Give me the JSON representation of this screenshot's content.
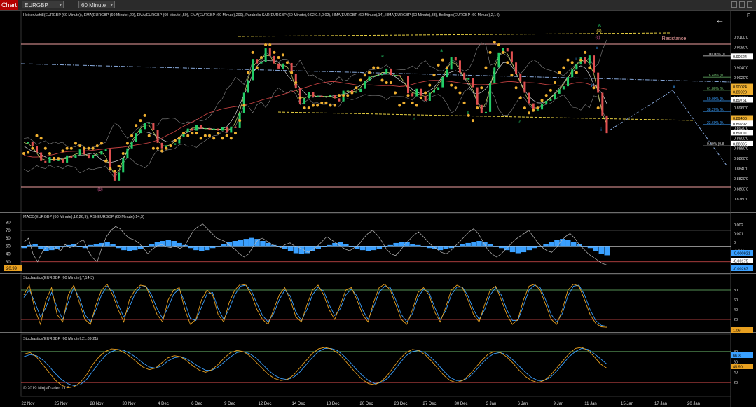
{
  "toolbar": {
    "chart_tab": "Chart",
    "instrument": "EURGBP",
    "timeframe": "60 Minute",
    "f_label": "F"
  },
  "colors": {
    "background": "#000000",
    "bullish": "#22cc66",
    "bearish": "#e05050",
    "psar": "#f0b030",
    "ema": "#c04040",
    "hma": "#d0d0d0",
    "macd_hist": "#3aa0ff",
    "stoch_k": "#e8a020",
    "stoch_d": "#3aa0ff",
    "resistance": "#f0a0a0",
    "channel": "#e8d040",
    "dashdot": "#88aadd"
  },
  "chart_data": [
    {
      "type": "line",
      "panel": "price",
      "title": "HeikenAshi8(EURGBP (60 Minute)), EMA(EURGBP (60 Minute),20), EMA(EURGBP (60 Minute),50), EMA(EURGBP (60 Minute),200), Parabolic SAR(EURGBP (60 Minute),0.02,0.2,0.02), HMA(EURGBP (60 Minute),14), HMA(EURGBP (60 Minute),33), Bollinger(EURGBP (60 Minute),2,14)",
      "x_labels": [
        "22 Nov",
        "25 Nov",
        "28 Nov",
        "30 Nov",
        "4 Dec",
        "6 Dec",
        "9 Dec",
        "12 Dec",
        "14 Dec",
        "18 Dec",
        "20 Dec",
        "23 Dec",
        "27 Dec",
        "30 Dec",
        "3 Jan",
        "6 Jan",
        "9 Jan",
        "11 Jan",
        "15 Jan",
        "17 Jan",
        "20 Jan"
      ],
      "y_ticks": [
        "0.9100'0",
        "0.9080'0",
        "0.9060'0",
        "0.9040'0",
        "0.9020'0",
        "0.9000'0",
        "0.8980'0",
        "0.8960'0",
        "0.8940'0",
        "0.8920'0",
        "0.8900'0",
        "0.8880'0",
        "0.8860'0",
        "0.8840'0",
        "0.8820'0",
        "0.8800'0",
        "0.8780'0"
      ],
      "ylim": [
        0.877,
        0.911
      ],
      "price_series": [
        0.889,
        0.8893,
        0.8884,
        0.8872,
        0.8855,
        0.8852,
        0.8863,
        0.8855,
        0.8859,
        0.8852,
        0.8866,
        0.8861,
        0.8867,
        0.8878,
        0.8868,
        0.886,
        0.8867,
        0.8868,
        0.8875,
        0.8878,
        0.8836,
        0.8816,
        0.8832,
        0.886,
        0.888,
        0.8893,
        0.891,
        0.8918,
        0.893,
        0.893,
        0.8917,
        0.8891,
        0.888,
        0.8886,
        0.8887,
        0.889,
        0.8903,
        0.8912,
        0.8919,
        0.8915,
        0.8926,
        0.8919,
        0.892,
        0.8917,
        0.8919,
        0.8915,
        0.8922,
        0.8911,
        0.8923,
        0.892,
        0.895,
        0.899,
        0.9015,
        0.9057,
        0.9048,
        0.9051,
        0.9078,
        0.9063,
        0.9048,
        0.9038,
        0.9048,
        0.9049,
        0.9028,
        0.8999,
        0.8967,
        0.8979,
        0.8992,
        0.8981,
        0.8984,
        0.8981,
        0.8983,
        0.8986,
        0.8979,
        0.8973,
        0.8994,
        0.8996,
        0.899,
        0.8992,
        0.8998,
        0.9013,
        0.9022,
        0.9023,
        0.9025,
        0.9028,
        0.9038,
        0.9025,
        0.9025,
        0.9024,
        0.9023,
        0.8989,
        0.8983,
        0.8998,
        0.8984,
        0.8974,
        0.899,
        0.8996,
        0.9001,
        0.9021,
        0.9036,
        0.906,
        0.9054,
        0.903,
        0.9016,
        0.9019,
        0.9001,
        0.8966,
        0.8949,
        0.8952,
        0.9009,
        0.904,
        0.907,
        0.9079,
        0.9072,
        0.905,
        0.9028,
        0.9012,
        0.899,
        0.8969,
        0.8955,
        0.8957,
        0.8968,
        0.8974,
        0.8977,
        0.8988,
        0.8997,
        0.9003,
        0.9021,
        0.9036,
        0.9046,
        0.906,
        0.9048,
        0.9064,
        0.903,
        0.899,
        0.8945,
        0.891
      ],
      "psar_series": [
        0.887,
        0.8872,
        0.888,
        0.8905,
        0.89,
        0.888,
        0.887,
        0.886,
        0.886,
        0.8875,
        0.888,
        0.888,
        0.889,
        0.8885,
        0.888,
        0.888,
        0.888,
        0.8885,
        0.889,
        0.8855,
        0.884,
        0.8835,
        0.8845,
        0.887,
        0.889,
        0.8905,
        0.8925,
        0.8935,
        0.8945,
        0.8905,
        0.888,
        0.888,
        0.8875,
        0.888,
        0.8885,
        0.8895,
        0.89,
        0.891,
        0.8905,
        0.891,
        0.891,
        0.89,
        0.8905,
        0.8905,
        0.89,
        0.891,
        0.89,
        0.8905,
        0.89,
        0.891,
        0.8935,
        0.8965,
        0.903,
        0.907,
        0.904,
        0.906,
        0.9085,
        0.9085,
        0.907,
        0.906,
        0.9065,
        0.905,
        0.903,
        0.901,
        0.898,
        0.896,
        0.896,
        0.8965,
        0.8965,
        0.897,
        0.897,
        0.8965,
        0.8965,
        0.8985,
        0.8985,
        0.8985,
        0.899,
        0.9,
        0.9015,
        0.9025,
        0.903,
        0.904,
        0.904,
        0.9015,
        0.901,
        0.901,
        0.899,
        0.8965,
        0.897,
        0.8985,
        0.897,
        0.8965,
        0.898,
        0.899,
        0.9005,
        0.9025,
        0.9045,
        0.9055,
        0.904,
        0.9005,
        0.9,
        0.899,
        0.897,
        0.8945,
        0.8935,
        0.896,
        0.9,
        0.904,
        0.907,
        0.909,
        0.9085,
        0.907,
        0.905,
        0.9025,
        0.9,
        0.898,
        0.896,
        0.895,
        0.8955,
        0.896,
        0.8975,
        0.8985,
        0.8995,
        0.901,
        0.903,
        0.904,
        0.9055,
        0.905,
        0.903,
        0.9055,
        0.907,
        0.904,
        0.9,
        0.896
      ],
      "right_axis_labels": [
        {
          "text": "0.90624",
          "value": 0.90624,
          "bg": "#ffffff",
          "fg": "#000000"
        },
        {
          "text": "0.90024",
          "value": 0.90024,
          "bg": "#f0b030",
          "fg": "#000000"
        },
        {
          "text": "0.89920",
          "value": 0.8992,
          "bg": "#f0b030",
          "fg": "#000000"
        },
        {
          "text": "0.89761",
          "value": 0.89761,
          "bg": "#ffffff",
          "fg": "#000000"
        },
        {
          "text": "0.89400",
          "value": 0.894,
          "bg": "#f0b030",
          "fg": "#000000"
        },
        {
          "text": "0.89292",
          "value": 0.89292,
          "bg": "#ffffff",
          "fg": "#000000"
        },
        {
          "text": "0.89110",
          "value": 0.8911,
          "bg": "#ffffff",
          "fg": "#000000"
        },
        {
          "text": "0.88895",
          "value": 0.88895,
          "bg": "#ffffff",
          "fg": "#000000"
        }
      ],
      "fib_levels": [
        {
          "label": "100.00% (0.",
          "value": 0.9063,
          "color": "#dddddd"
        },
        {
          "label": "76.40% (0.",
          "value": 0.9021,
          "color": "#6fbf6f"
        },
        {
          "label": "61.80% (0.",
          "value": 0.8995,
          "color": "#6fbf6f"
        },
        {
          "label": "50.00% (0.",
          "value": 0.8974,
          "color": "#3aa0ff"
        },
        {
          "label": "38.20% (0.",
          "value": 0.8953,
          "color": "#3aa0ff"
        },
        {
          "label": "23.60% (0.",
          "value": 0.8927,
          "color": "#3aa0ff"
        },
        {
          "label": "0.00% (0.8",
          "value": 0.8885,
          "color": "#dddddd"
        }
      ],
      "annotations": [
        {
          "text": "(b)",
          "color": "#e060a0"
        },
        {
          "text": "Resistance",
          "color": "#f0a0a0"
        },
        {
          "text": "(c)",
          "color": "#e060a0"
        },
        {
          "text": "B",
          "color": "#22cc66"
        },
        {
          "text": "(a)",
          "color": "#e8d040"
        },
        {
          "text": "v",
          "color": "#3aa0ff"
        },
        {
          "text": "iii",
          "color": "#3aa0ff"
        },
        {
          "text": "iv",
          "color": "#3aa0ff"
        },
        {
          "text": "i",
          "color": "#3aa0ff"
        },
        {
          "text": "ii",
          "color": "#3aa0ff"
        },
        {
          "text": "a",
          "color": "#22cc66"
        },
        {
          "text": "b",
          "color": "#22cc66"
        },
        {
          "text": "c",
          "color": "#22cc66"
        },
        {
          "text": "d",
          "color": "#22cc66"
        },
        {
          "text": "e",
          "color": "#22cc66"
        }
      ]
    },
    {
      "type": "line",
      "panel": "macd_rsi",
      "title": "MACD(EURGBP (60 Minute),12,26,9), RSI(EURGBP (60 Minute),14,3)",
      "left_ticks": [
        "80",
        "70",
        "60",
        "50",
        "40",
        "30"
      ],
      "right_ticks": [
        "0.002",
        "0.001",
        "0",
        "-0.001",
        "-0.002"
      ],
      "rsi_ylim": [
        20,
        85
      ],
      "rsi_series": [
        55,
        60,
        40,
        30,
        42,
        50,
        46,
        48,
        44,
        52,
        48,
        50,
        55,
        58,
        44,
        35,
        30,
        48,
        62,
        70,
        75,
        72,
        65,
        60,
        58,
        54,
        48,
        40,
        46,
        50,
        52,
        49,
        48,
        50,
        47,
        50,
        60,
        70,
        75,
        78,
        72,
        66,
        60,
        58,
        55,
        50,
        46,
        40,
        36,
        40,
        50,
        58,
        60,
        56,
        52,
        50,
        48,
        52,
        54,
        50,
        48,
        45,
        42,
        46,
        50,
        56,
        62,
        58,
        54,
        50,
        46,
        44,
        48,
        52,
        60,
        66,
        70,
        64,
        56,
        46,
        40,
        38,
        44,
        52,
        58,
        64,
        68,
        62,
        56,
        50,
        46,
        42,
        40,
        44,
        50,
        56,
        62,
        68,
        72,
        66,
        56,
        46,
        40,
        36,
        40,
        46,
        52,
        58,
        62,
        66,
        70,
        62,
        54,
        48,
        44,
        42,
        48,
        56,
        62,
        66,
        60,
        52,
        46,
        40,
        36,
        32,
        28,
        26
      ],
      "macd_hist_ylim": [
        -0.0025,
        0.0025
      ],
      "macd_hist": [
        -0.0002,
        0.0001,
        0.0002,
        -0.0003,
        -0.0005,
        -0.0004,
        -0.0003,
        0.0,
        0.0001,
        0.0002,
        -0.0001,
        -0.0002,
        0.0001,
        0.0002,
        0.0003,
        0.0004,
        0.0002,
        -0.0002,
        -0.0004,
        -0.0005,
        -0.0004,
        -0.0003,
        -0.0001,
        0.0002,
        0.0004,
        0.0005,
        0.0006,
        0.0005,
        0.0003,
        0.0001,
        -0.0002,
        -0.0004,
        -0.0005,
        -0.0004,
        -0.0002,
        0.0,
        0.0002,
        0.0004,
        0.0005,
        0.0006,
        0.0007,
        0.0008,
        0.0007,
        0.0005,
        0.0003,
        0.0001,
        -0.0001,
        -0.0003,
        -0.0005,
        -0.0007,
        -0.0008,
        -0.0007,
        -0.0005,
        -0.0003,
        -0.0001,
        0.0001,
        0.0003,
        0.0004,
        0.0002,
        -0.0001,
        -0.0003,
        -0.0004,
        -0.0005,
        -0.0004,
        -0.0003,
        -0.0001,
        0.0001,
        0.0003,
        0.0004,
        0.0004,
        0.0002,
        0.0001,
        0.0,
        -0.0002,
        -0.0003,
        -0.0004,
        -0.0003,
        -0.0002,
        0.0,
        0.0002,
        0.0003,
        0.0004,
        0.0005,
        0.0004,
        0.0002,
        0.0,
        -0.0002,
        -0.0004,
        -0.0006,
        -0.0007,
        -0.0006,
        -0.0004,
        -0.0002,
        0.0,
        0.0002,
        0.0004,
        0.0006,
        0.0007,
        0.0006,
        0.0004,
        0.0002,
        0.0,
        -0.0002,
        -0.0005,
        -0.0008,
        -0.0009
      ],
      "right_axis_labels": [
        {
          "text": "-0.000921",
          "bg": "#3aa0ff",
          "fg": "#000000"
        },
        {
          "text": "-0.00175",
          "bg": "#ffffff",
          "fg": "#000000"
        },
        {
          "text": "-0.00267",
          "bg": "#3aa0ff",
          "fg": "#000000"
        }
      ],
      "left_axis_label": {
        "text": "20.99",
        "bg": "#e8a020",
        "fg": "#000000"
      }
    },
    {
      "type": "line",
      "panel": "stochastics_fast",
      "title": "Stochastics(EURGBP (60 Minute),7,14,3)",
      "right_ticks": [
        "80",
        "60",
        "40",
        "20"
      ],
      "ylim": [
        0,
        100
      ],
      "k_series": [
        70,
        90,
        40,
        10,
        60,
        85,
        30,
        15,
        70,
        90,
        55,
        20,
        10,
        50,
        80,
        92,
        70,
        40,
        15,
        60,
        80,
        90,
        88,
        60,
        30,
        15,
        60,
        80,
        85,
        40,
        10,
        20,
        60,
        80,
        70,
        30,
        15,
        55,
        80,
        92,
        90,
        70,
        40,
        20,
        10,
        40,
        70,
        85,
        60,
        25,
        15,
        50,
        80,
        90,
        70,
        40,
        20,
        50,
        80,
        85,
        60,
        30,
        15,
        55,
        85,
        92,
        80,
        50,
        20,
        10,
        40,
        75,
        85,
        70,
        35,
        15,
        45,
        80,
        90,
        85,
        60,
        30,
        15,
        50,
        80,
        88,
        60,
        30,
        10,
        20,
        60,
        88,
        92,
        80,
        50,
        20,
        10,
        40,
        80,
        92,
        88,
        60,
        30,
        12,
        5,
        4
      ],
      "d_series": [
        65,
        80,
        55,
        25,
        45,
        75,
        45,
        20,
        55,
        85,
        65,
        30,
        15,
        40,
        70,
        88,
        78,
        50,
        25,
        45,
        72,
        86,
        88,
        70,
        42,
        22,
        45,
        72,
        82,
        55,
        22,
        18,
        45,
        72,
        75,
        42,
        20,
        42,
        70,
        88,
        90,
        78,
        52,
        28,
        15,
        32,
        60,
        80,
        68,
        35,
        18,
        40,
        70,
        86,
        78,
        50,
        28,
        42,
        70,
        82,
        68,
        40,
        20,
        45,
        75,
        88,
        85,
        60,
        30,
        15,
        32,
        65,
        82,
        75,
        45,
        20,
        38,
        70,
        86,
        86,
        68,
        40,
        20,
        40,
        70,
        85,
        70,
        40,
        18,
        18,
        48,
        80,
        90,
        85,
        60,
        30,
        15,
        32,
        68,
        88,
        90,
        70,
        40,
        18,
        8,
        6
      ],
      "right_axis_labels": [
        {
          "text": "1.06",
          "bg": "#e8a020",
          "fg": "#000000"
        }
      ]
    },
    {
      "type": "line",
      "panel": "stochastics_slow",
      "title": "Stochastics(EURGBP (60 Minute),21,89,21)",
      "right_ticks": [
        "80",
        "60",
        "40",
        "20"
      ],
      "ylim": [
        0,
        100
      ],
      "k_series": [
        75,
        78,
        70,
        55,
        40,
        25,
        15,
        10,
        12,
        20,
        35,
        55,
        70,
        80,
        85,
        84,
        78,
        70,
        60,
        50,
        45,
        48,
        58,
        68,
        72,
        70,
        62,
        52,
        44,
        40,
        45,
        55,
        68,
        78,
        82,
        80,
        72,
        60,
        48,
        36,
        28,
        24,
        26,
        34,
        48,
        62,
        76,
        85,
        88,
        85,
        78,
        66,
        52,
        38,
        26,
        18,
        16,
        22,
        34,
        50,
        66,
        78,
        84,
        82,
        74,
        62,
        48,
        34,
        24,
        20,
        24,
        34,
        48,
        62,
        74,
        80,
        78,
        70,
        58,
        44,
        32,
        24,
        20,
        24,
        34,
        48,
        62,
        76,
        86,
        88,
        82,
        70,
        56,
        48
      ],
      "d_series": [
        70,
        74,
        72,
        64,
        52,
        38,
        26,
        18,
        14,
        16,
        26,
        42,
        58,
        72,
        80,
        84,
        82,
        76,
        68,
        58,
        50,
        48,
        52,
        62,
        68,
        70,
        66,
        58,
        50,
        44,
        44,
        50,
        60,
        70,
        78,
        80,
        76,
        68,
        56,
        44,
        34,
        28,
        26,
        30,
        40,
        54,
        68,
        80,
        86,
        86,
        82,
        72,
        60,
        46,
        34,
        24,
        18,
        20,
        28,
        42,
        58,
        72,
        80,
        82,
        78,
        68,
        56,
        42,
        30,
        24,
        24,
        30,
        42,
        56,
        68,
        76,
        78,
        74,
        64,
        52,
        40,
        30,
        24,
        24,
        30,
        42,
        56,
        70,
        80,
        86,
        84,
        76,
        66,
        56
      ],
      "right_axis_labels": [
        {
          "text": "66.3",
          "bg": "#3aa0ff",
          "fg": "#000000"
        },
        {
          "text": "45.90",
          "bg": "#e8a020",
          "fg": "#000000"
        }
      ]
    }
  ],
  "copyright": "© 2019 NinjaTrader, LLC"
}
